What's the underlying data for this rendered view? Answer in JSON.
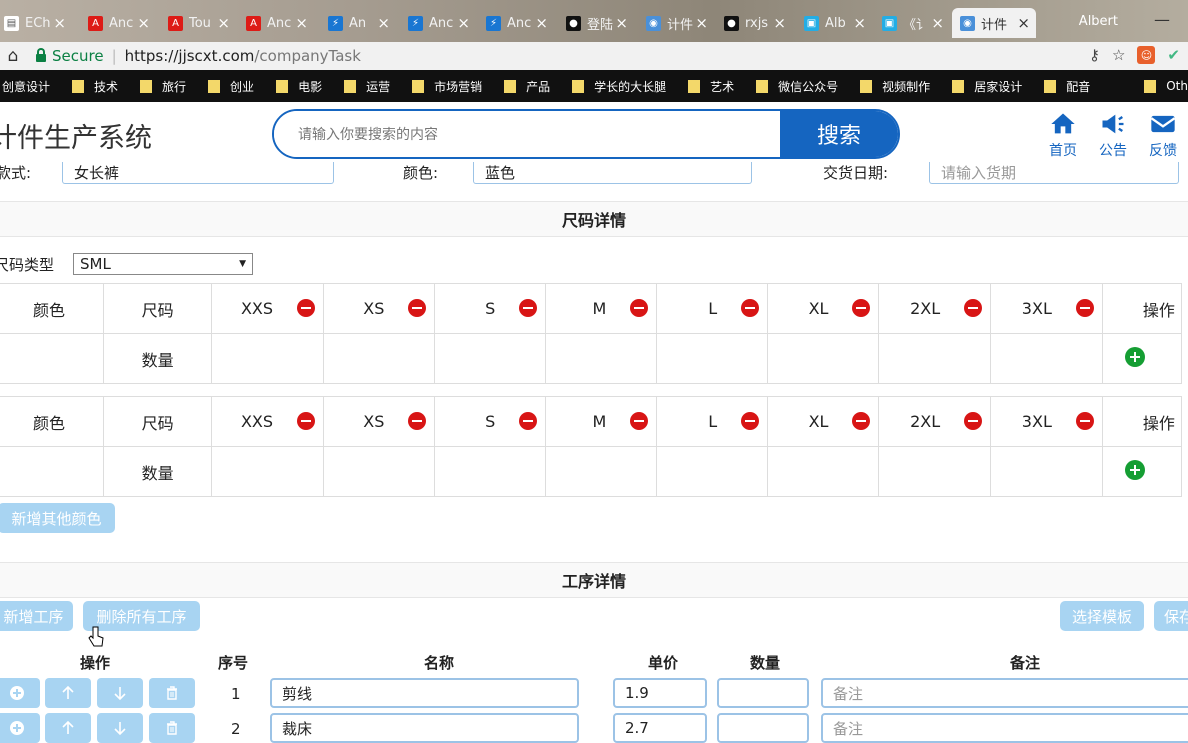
{
  "browser": {
    "tabs": [
      {
        "label": "ECh",
        "icon": "page-icon",
        "color": "#ffffff"
      },
      {
        "label": "Anc",
        "icon": "angular-icon",
        "color": "#dd1b16"
      },
      {
        "label": "Tou",
        "icon": "angular-icon",
        "color": "#dd1b16"
      },
      {
        "label": "Anc",
        "icon": "angular-icon",
        "color": "#dd1b16"
      },
      {
        "label": "An",
        "icon": "lightning-icon",
        "color": "#1976d2"
      },
      {
        "label": "Anc",
        "icon": "lightning-icon",
        "color": "#1976d2"
      },
      {
        "label": "Anc",
        "icon": "lightning-icon",
        "color": "#1976d2"
      },
      {
        "label": "登陆",
        "icon": "github-icon",
        "color": "#111111"
      },
      {
        "label": "计件",
        "icon": "web-icon",
        "color": "#4a90d9"
      },
      {
        "label": "rxjs",
        "icon": "github-icon",
        "color": "#111111"
      },
      {
        "label": "Alb",
        "icon": "bilibili-icon",
        "color": "#23ade5"
      },
      {
        "label": "《讠",
        "icon": "bilibili-icon",
        "color": "#23ade5"
      },
      {
        "label": "计件",
        "icon": "web-icon",
        "color": "#4a90d9",
        "active": true
      }
    ],
    "user_name": "Albert",
    "address": {
      "secure_label": "Secure",
      "url_host": "https://jjscxt.com",
      "url_path": "/companyTask"
    },
    "bookmarks": [
      "创意设计",
      "技术",
      "旅行",
      "创业",
      "电影",
      "运营",
      "市场营销",
      "产品",
      "学长的大长腿",
      "艺术",
      "微信公众号",
      "视频制作",
      "居家设计",
      "配音"
    ],
    "bookmarks_overflow": "Oth"
  },
  "header": {
    "brand": "计件生产系统",
    "search_placeholder": "请输入你要搜索的内容",
    "search_button": "搜索",
    "nav": [
      {
        "label": "首页",
        "icon": "home-icon"
      },
      {
        "label": "公告",
        "icon": "megaphone-icon"
      },
      {
        "label": "反馈",
        "icon": "envelope-icon"
      }
    ]
  },
  "order": {
    "style_label": "款式:",
    "style_value": "女长裤",
    "color_label": "颜色:",
    "color_value": "蓝色",
    "delivery_label": "交货日期:",
    "delivery_placeholder": "请输入货期"
  },
  "size_section": {
    "title": "尺码详情",
    "size_type_label": "尺码类型",
    "size_type_value": "SML",
    "color_header": "颜色",
    "size_header": "尺码",
    "qty_label": "数量",
    "action_header": "操作",
    "sizes": [
      "XXS",
      "XS",
      "S",
      "M",
      "L",
      "XL",
      "2XL",
      "3XL"
    ],
    "add_color_button": "新增其他颜色"
  },
  "process_section": {
    "title": "工序详情",
    "add_button": "新增工序",
    "delete_all_button": "删除所有工序",
    "template_button": "选择模板",
    "save_button": "保存",
    "columns": {
      "action": "操作",
      "index": "序号",
      "name": "名称",
      "price": "单价",
      "qty": "数量",
      "note": "备注"
    },
    "rows": [
      {
        "index": "1",
        "name": "剪线",
        "price": "1.9",
        "qty": "",
        "note_placeholder": "备注"
      },
      {
        "index": "2",
        "name": "裁床",
        "price": "2.7",
        "qty": "",
        "note_placeholder": "备注"
      }
    ]
  },
  "colors": {
    "primary": "#1565c0",
    "light_button": "#a8d4f2",
    "remove": "#d81515",
    "add": "#159e33"
  }
}
